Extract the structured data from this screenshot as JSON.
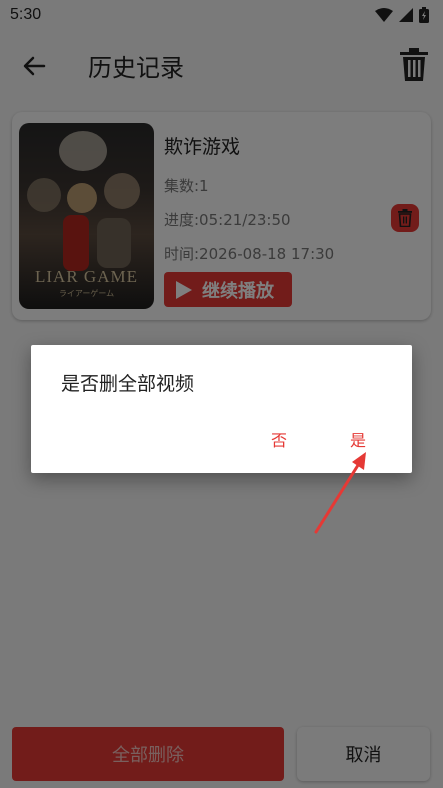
{
  "status_bar": {
    "time": "5:30"
  },
  "app_bar": {
    "title": "历史记录"
  },
  "history_items": [
    {
      "poster_title": "LIAR GAME",
      "poster_subtitle": "ライアーゲーム",
      "title": "欺诈游戏",
      "episodes": "集数:1",
      "progress": "进度:05:21/23:50",
      "time": "时间:2026-08-18 17:30",
      "continue_label": "继续播放"
    }
  ],
  "bottom_bar": {
    "delete_all_label": "全部删除",
    "cancel_label": "取消"
  },
  "dialog": {
    "message": "是否删全部视频",
    "no_label": "否",
    "yes_label": "是"
  },
  "colors": {
    "accent": "#e53935",
    "annotation_arrow": "#e53935"
  }
}
